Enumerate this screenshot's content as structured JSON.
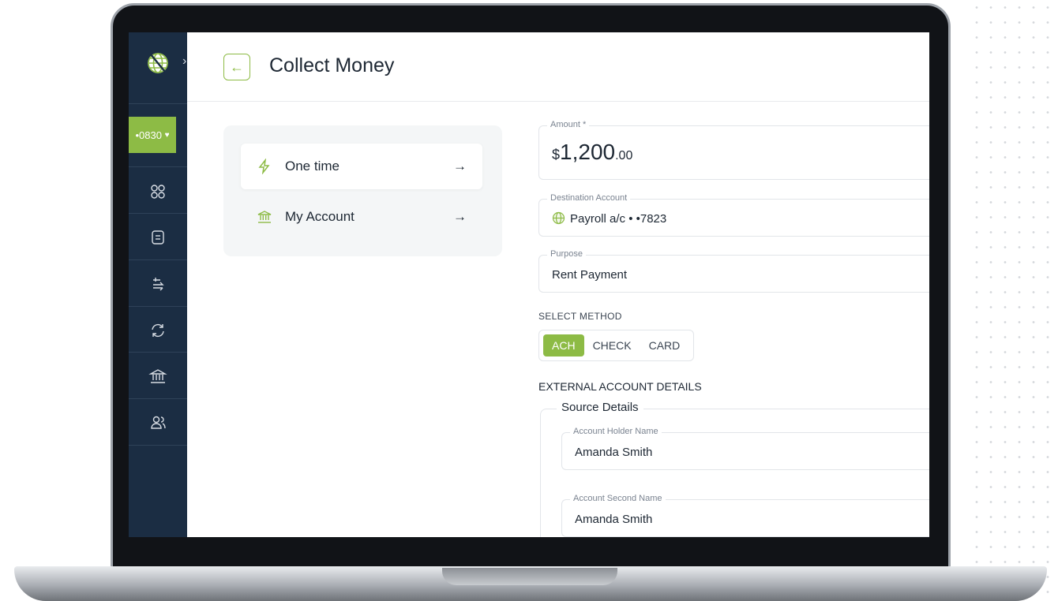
{
  "sidebar": {
    "account_pill": "•0830",
    "icons": [
      "dashboard-icon",
      "document-icon",
      "transfer-icon",
      "refresh-icon",
      "bank-icon",
      "users-icon"
    ]
  },
  "header": {
    "back_icon": "←",
    "title": "Collect Money"
  },
  "options": [
    {
      "label": "One time",
      "icon": "lightning-icon",
      "arrow": "→"
    },
    {
      "label": "My Account",
      "icon": "bank-icon",
      "arrow": "→"
    }
  ],
  "form": {
    "amount": {
      "label": "Amount *",
      "currency": "$",
      "whole": "1,200",
      "decimal": ".00"
    },
    "destination": {
      "label": "Destination Account",
      "value": "Payroll a/c • •7823"
    },
    "purpose": {
      "label": "Purpose",
      "value": "Rent Payment"
    },
    "select_method_label": "SELECT METHOD",
    "methods": [
      "ACH",
      "CHECK",
      "CARD"
    ],
    "selected_method": "ACH",
    "external_label": "EXTERNAL ACCOUNT DETAILS",
    "source": {
      "legend": "Source Details",
      "holder": {
        "label": "Account Holder Name",
        "value": "Amanda Smith"
      },
      "second": {
        "label": "Account Second  Name",
        "value": "Amanda Smith"
      }
    }
  },
  "colors": {
    "accent": "#8dbb45",
    "sidebar": "#1b2d43"
  }
}
